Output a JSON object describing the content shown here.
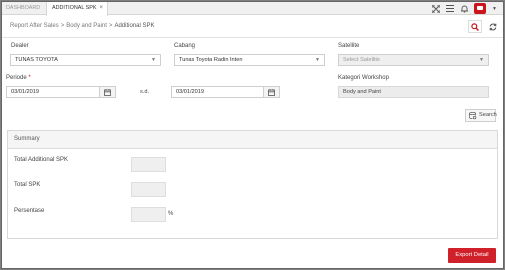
{
  "tabs": {
    "dashboard": "DASHBOARD",
    "active": "ADDITIONAL SPK",
    "close_glyph": "×"
  },
  "topbar": {
    "icons": [
      "expand-icon",
      "menu-icon",
      "bell-icon",
      "user-icon",
      "caret-down-icon"
    ]
  },
  "breadcrumb": {
    "items": [
      "Report After Sales",
      "Body and Paint",
      "Additional SPK"
    ],
    "separator": ">"
  },
  "form": {
    "dealer_label": "Dealer",
    "dealer_value": "TUNAS TOYOTA",
    "cabang_label": "Cabang",
    "cabang_value": "Tunas Toyota Radin Inten",
    "satellite_label": "Satellite",
    "satellite_placeholder": "Select Satellite",
    "periode_label": "Periode",
    "periode_required": "*",
    "date_from": "03/01/2019",
    "sd_label": "s.d.",
    "date_to": "03/01/2019",
    "kategori_label": "Kategori Workshop",
    "kategori_value": "Body and Paint",
    "search_button": "Search"
  },
  "summary": {
    "title": "Summary",
    "total_additional_label": "Total Additional SPK",
    "total_additional_value": "",
    "total_spk_label": "Total SPK",
    "total_spk_value": "",
    "persentase_label": "Persentase",
    "persentase_value": "",
    "percent_sign": "%"
  },
  "export_button": "Export Detail",
  "colors": {
    "accent": "#d0202a",
    "panel_header": "#f5f5f5"
  }
}
